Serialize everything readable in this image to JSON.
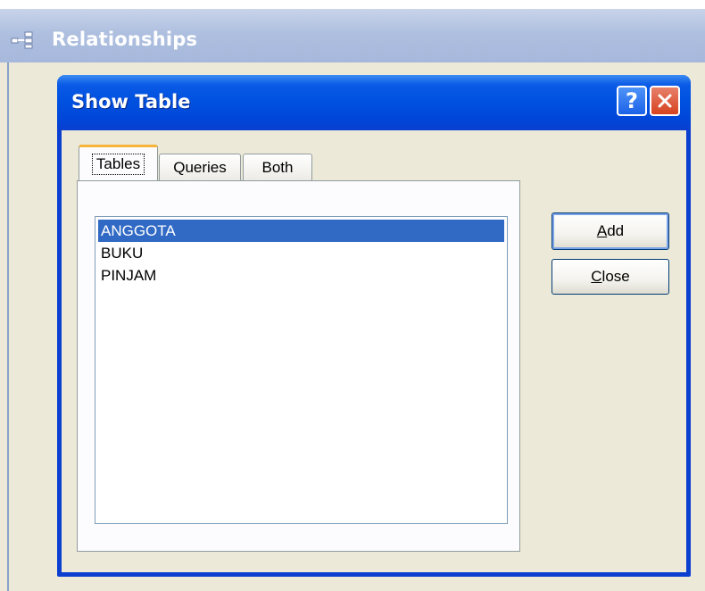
{
  "outer_window": {
    "title": "Relationships",
    "icon": "relationships-icon"
  },
  "dialog": {
    "title": "Show Table",
    "help_button": "?",
    "close_button": "✕"
  },
  "tabs": [
    {
      "label": "Tables",
      "active": true
    },
    {
      "label": "Queries",
      "active": false
    },
    {
      "label": "Both",
      "active": false
    }
  ],
  "table_list": {
    "items": [
      {
        "label": "ANGGOTA",
        "selected": true
      },
      {
        "label": "BUKU",
        "selected": false
      },
      {
        "label": "PINJAM",
        "selected": false
      }
    ]
  },
  "buttons": {
    "add": {
      "mnemonic": "A",
      "rest": "dd"
    },
    "close": {
      "mnemonic": "C",
      "rest": "lose"
    }
  },
  "colors": {
    "xp_titlebar_blue": "#0050e0",
    "selection_blue": "#316ac5",
    "dialog_background": "#ece9d8",
    "active_tab_highlight": "#f7b43a"
  }
}
